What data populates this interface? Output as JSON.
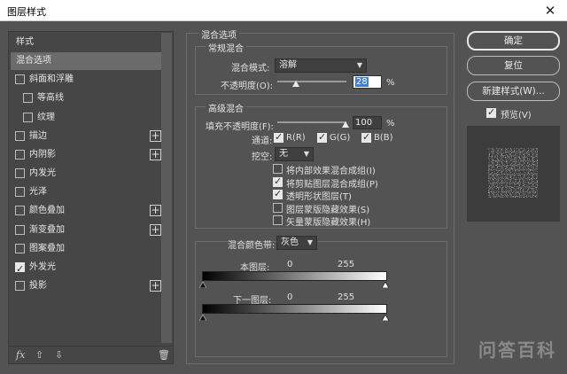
{
  "window": {
    "title": "图层样式"
  },
  "left_panel": {
    "items": [
      {
        "label": "样式",
        "checkbox": null,
        "plus": false,
        "selected": false
      },
      {
        "label": "混合选项",
        "checkbox": null,
        "plus": false,
        "selected": true
      },
      {
        "label": "斜面和浮雕",
        "checkbox": false,
        "plus": false,
        "selected": false
      },
      {
        "label": "等高线",
        "checkbox": false,
        "plus": false,
        "selected": false,
        "indent": true
      },
      {
        "label": "纹理",
        "checkbox": false,
        "plus": false,
        "selected": false,
        "indent": true
      },
      {
        "label": "描边",
        "checkbox": false,
        "plus": true,
        "selected": false
      },
      {
        "label": "内阴影",
        "checkbox": false,
        "plus": true,
        "selected": false
      },
      {
        "label": "内发光",
        "checkbox": false,
        "plus": false,
        "selected": false
      },
      {
        "label": "光泽",
        "checkbox": false,
        "plus": false,
        "selected": false
      },
      {
        "label": "颜色叠加",
        "checkbox": false,
        "plus": true,
        "selected": false
      },
      {
        "label": "渐变叠加",
        "checkbox": false,
        "plus": true,
        "selected": false
      },
      {
        "label": "图案叠加",
        "checkbox": false,
        "plus": false,
        "selected": false
      },
      {
        "label": "外发光",
        "checkbox": true,
        "plus": false,
        "selected": false
      },
      {
        "label": "投影",
        "checkbox": false,
        "plus": true,
        "selected": false
      }
    ],
    "fx_label": "fx"
  },
  "blend_options": {
    "title": "混合选项",
    "general": {
      "title": "常规混合",
      "mode_label": "混合模式:",
      "mode_value": "溶解",
      "opacity_label": "不透明度(O):",
      "opacity_value": "28",
      "opacity_unit": "%"
    },
    "advanced": {
      "title": "高级混合",
      "fill_label": "填充不透明度(F):",
      "fill_value": "100",
      "fill_unit": "%",
      "channels_label": "通道:",
      "channels": [
        {
          "label": "R(R)",
          "checked": true
        },
        {
          "label": "G(G)",
          "checked": true
        },
        {
          "label": "B(B)",
          "checked": true
        }
      ],
      "knockout_label": "挖空:",
      "knockout_value": "无",
      "options": [
        {
          "label": "将内部效果混合成组(I)",
          "checked": false
        },
        {
          "label": "将剪贴图层混合成组(P)",
          "checked": true
        },
        {
          "label": "透明形状图层(T)",
          "checked": true
        },
        {
          "label": "图层蒙版隐藏效果(S)",
          "checked": false
        },
        {
          "label": "矢量蒙版隐藏效果(H)",
          "checked": false
        }
      ]
    },
    "blend_if": {
      "label": "混合颜色带:",
      "value": "灰色",
      "this_layer_label": "本图层:",
      "this_layer_min": "0",
      "this_layer_max": "255",
      "under_layer_label": "下一图层:",
      "under_layer_min": "0",
      "under_layer_max": "255"
    }
  },
  "buttons": {
    "ok": "确定",
    "reset": "复位",
    "new_style": "新建样式(W)...",
    "preview_label": "预览(V)",
    "preview_checked": true
  },
  "watermark": "问答百科"
}
